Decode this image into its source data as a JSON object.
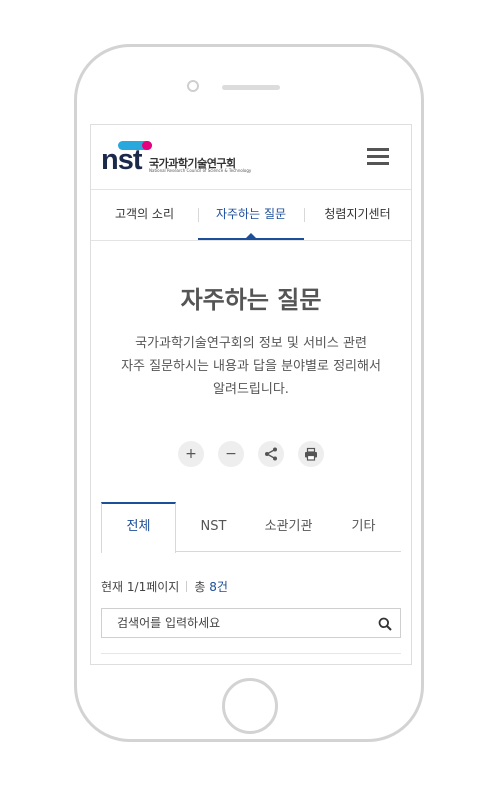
{
  "header": {
    "logo_text": "nst",
    "logo_korean": "국가과학기술연구회",
    "logo_english": "National Research Council of Science & Technology",
    "menu_icon": "hamburger-menu-icon"
  },
  "nav": {
    "items": [
      {
        "label": "고객의 소리"
      },
      {
        "label": "자주하는 질문"
      },
      {
        "label": "청렴지기센터"
      }
    ],
    "active_index": 1
  },
  "main": {
    "title": "자주하는 질문",
    "description_lines": [
      "국가과학기술연구회의 정보 및 서비스 관련",
      "자주 질문하시는 내용과 답을 분야별로 정리해서",
      "알려드립니다."
    ]
  },
  "tools": [
    {
      "icon": "zoom-in-icon",
      "glyph": "+"
    },
    {
      "icon": "zoom-out-icon",
      "glyph": "−"
    },
    {
      "icon": "share-icon",
      "glyph": ""
    },
    {
      "icon": "print-icon",
      "glyph": ""
    }
  ],
  "category_tabs": {
    "items": [
      {
        "label": "전체"
      },
      {
        "label": "NST"
      },
      {
        "label": "소관기관"
      },
      {
        "label": "기타"
      }
    ],
    "active_index": 0
  },
  "page_info": {
    "current": "현재 1/1페이지",
    "total_prefix": "총",
    "total_count": "8건"
  },
  "search": {
    "placeholder": "검색어를 입력하세요",
    "value": ""
  },
  "colors": {
    "accent": "#1d4e9a",
    "logo_blue": "#29a8de",
    "logo_pink": "#e6007e",
    "logo_navy": "#1b2a4a"
  }
}
